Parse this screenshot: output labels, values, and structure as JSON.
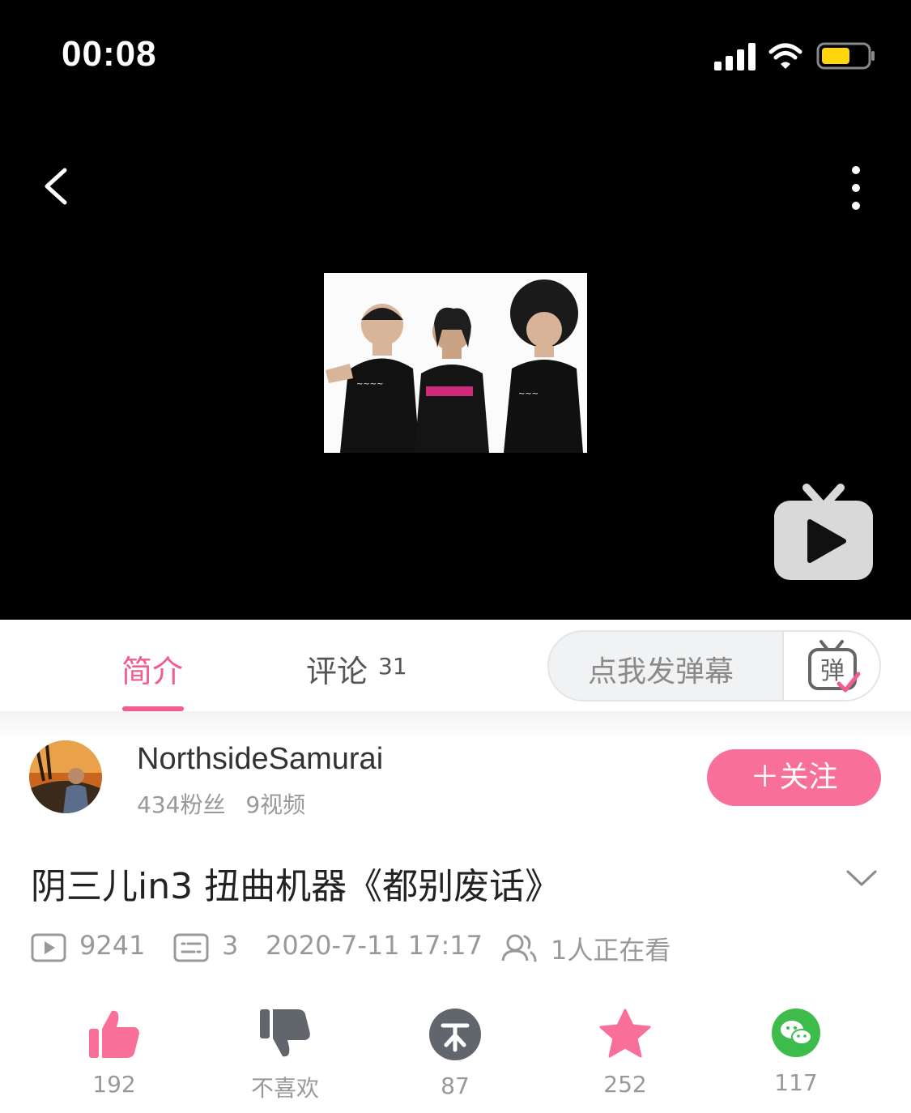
{
  "status_bar": {
    "time": "00:08"
  },
  "player": {
    "icons": {
      "back": "chevron-left-icon",
      "more": "more-vertical-icon",
      "tv": "tv-play-icon"
    }
  },
  "tabs": {
    "intro_label": "简介",
    "comments_label": "评论",
    "comments_count": "31",
    "active": "intro",
    "accent_color": "#f25d8e"
  },
  "danmaku": {
    "placeholder": "点我发弹幕",
    "toggle_char": "弹"
  },
  "author": {
    "name": "NorthsideSamurai",
    "fans": "434粉丝",
    "videos": "9视频",
    "follow_label": "＋关注"
  },
  "video": {
    "title": "阴三儿in3  扭曲机器《都别废话》",
    "plays": "9241",
    "danmaku_count": "3",
    "date": "2020-7-11 17:17",
    "watching": "1人正在看"
  },
  "actions": {
    "like": "192",
    "dislike": "不喜欢",
    "coin": "87",
    "favorite": "252",
    "share": "117"
  }
}
